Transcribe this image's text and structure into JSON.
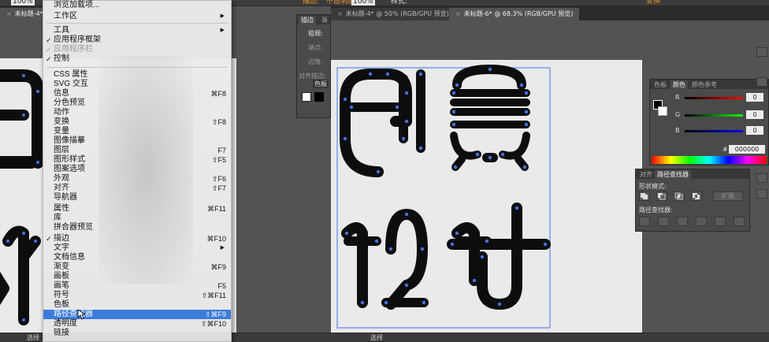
{
  "option_bar": {
    "zoom": "100%",
    "stroke_label": "描边:",
    "opacity_label": "不透明度:",
    "opacity_value": "100%",
    "style_label": "样式:",
    "transform_label": "变换"
  },
  "tabs": {
    "left_doc": "未标题-4* @ 50%",
    "doc_a": "未标题-4* @ 50% (RGB/GPU 预览)",
    "doc_b": "未标题-6* @ 68.3% (RGB/GPU 预览)"
  },
  "menu": {
    "items": [
      {
        "label": "浏览加载项...",
        "checked": false,
        "shortcut": "",
        "submenu": false,
        "disabled": false
      },
      {
        "label": "工作区",
        "checked": false,
        "shortcut": "",
        "submenu": true,
        "disabled": false
      },
      {
        "label": "工具",
        "checked": false,
        "shortcut": "",
        "submenu": true,
        "disabled": false
      },
      {
        "label": "应用程序框架",
        "checked": true,
        "shortcut": "",
        "submenu": false,
        "disabled": false
      },
      {
        "label": "应用程序栏",
        "checked": true,
        "shortcut": "",
        "submenu": false,
        "disabled": true
      },
      {
        "label": "控制",
        "checked": true,
        "shortcut": "",
        "submenu": false,
        "disabled": false
      },
      {
        "label": "CSS 属性",
        "checked": false,
        "shortcut": "",
        "submenu": false,
        "disabled": false
      },
      {
        "label": "SVG 交互",
        "checked": false,
        "shortcut": "",
        "submenu": false,
        "disabled": false
      },
      {
        "label": "信息",
        "checked": false,
        "shortcut": "⌘F8",
        "submenu": false,
        "disabled": false
      },
      {
        "label": "分色预览",
        "checked": false,
        "shortcut": "",
        "submenu": false,
        "disabled": false
      },
      {
        "label": "动作",
        "checked": false,
        "shortcut": "",
        "submenu": false,
        "disabled": false
      },
      {
        "label": "变换",
        "checked": false,
        "shortcut": "⇧F8",
        "submenu": false,
        "disabled": false
      },
      {
        "label": "变量",
        "checked": false,
        "shortcut": "",
        "submenu": false,
        "disabled": false
      },
      {
        "label": "图像描摹",
        "checked": false,
        "shortcut": "",
        "submenu": false,
        "disabled": false
      },
      {
        "label": "图层",
        "checked": false,
        "shortcut": "F7",
        "submenu": false,
        "disabled": false
      },
      {
        "label": "图形样式",
        "checked": false,
        "shortcut": "⇧F5",
        "submenu": false,
        "disabled": false
      },
      {
        "label": "图案选项",
        "checked": false,
        "shortcut": "",
        "submenu": false,
        "disabled": false
      },
      {
        "label": "外观",
        "checked": false,
        "shortcut": "⇧F6",
        "submenu": false,
        "disabled": false
      },
      {
        "label": "对齐",
        "checked": false,
        "shortcut": "⇧F7",
        "submenu": false,
        "disabled": false
      },
      {
        "label": "导航器",
        "checked": false,
        "shortcut": "",
        "submenu": false,
        "disabled": false
      },
      {
        "label": "属性",
        "checked": false,
        "shortcut": "⌘F11",
        "submenu": false,
        "disabled": false
      },
      {
        "label": "库",
        "checked": false,
        "shortcut": "",
        "submenu": false,
        "disabled": false
      },
      {
        "label": "拼合器预览",
        "checked": false,
        "shortcut": "",
        "submenu": false,
        "disabled": false
      },
      {
        "label": "描边",
        "checked": true,
        "shortcut": "⌘F10",
        "submenu": false,
        "disabled": false
      },
      {
        "label": "文字",
        "checked": false,
        "shortcut": "",
        "submenu": true,
        "disabled": false
      },
      {
        "label": "文档信息",
        "checked": false,
        "shortcut": "",
        "submenu": false,
        "disabled": false
      },
      {
        "label": "渐变",
        "checked": false,
        "shortcut": "⌘F9",
        "submenu": false,
        "disabled": false
      },
      {
        "label": "画板",
        "checked": false,
        "shortcut": "",
        "submenu": false,
        "disabled": false
      },
      {
        "label": "画笔",
        "checked": false,
        "shortcut": "F5",
        "submenu": false,
        "disabled": false
      },
      {
        "label": "符号",
        "checked": false,
        "shortcut": "⇧⌘F11",
        "submenu": false,
        "disabled": false
      },
      {
        "label": "色板",
        "checked": false,
        "shortcut": "",
        "submenu": false,
        "disabled": false
      },
      {
        "label": "路径查找器",
        "checked": false,
        "shortcut": "⇧⌘F9",
        "submenu": false,
        "disabled": false,
        "highlighted": true
      },
      {
        "label": "透明度",
        "checked": false,
        "shortcut": "⇧⌘F10",
        "submenu": false,
        "disabled": false
      },
      {
        "label": "链接",
        "checked": false,
        "shortcut": "",
        "submenu": false,
        "disabled": false
      }
    ]
  },
  "stroke_panel": {
    "tab_stroke": "描边",
    "tab_other": "渐",
    "weight_label": "粗细:",
    "cap_label": "端点:",
    "corner_label": "边角:",
    "align_label": "对齐描边:",
    "swatch_tab": "色板"
  },
  "color_panel": {
    "tab_swatches": "色板",
    "tab_color": "颜色",
    "tab_guide": "颜色参考",
    "channels": [
      {
        "name": "R",
        "value": "0"
      },
      {
        "name": "G",
        "value": "0"
      },
      {
        "name": "B",
        "value": "0"
      }
    ],
    "hex_prefix": "#",
    "hex_value": "000000"
  },
  "pathfinder_panel": {
    "tab_align": "对齐",
    "tab_pathfinder": "路径查找器",
    "shape_modes_label": "形状模式:",
    "expand_label": "扩展",
    "pathfinders_label": "路径查找器:"
  },
  "status": {
    "left": "选择",
    "right": "选择"
  },
  "colors": {
    "highlight": "#3b7cdb",
    "anchor": "#3f74e8",
    "glyph": "#0d0d0d",
    "artboard": "#eaeaea",
    "accent": "#e8912d"
  }
}
